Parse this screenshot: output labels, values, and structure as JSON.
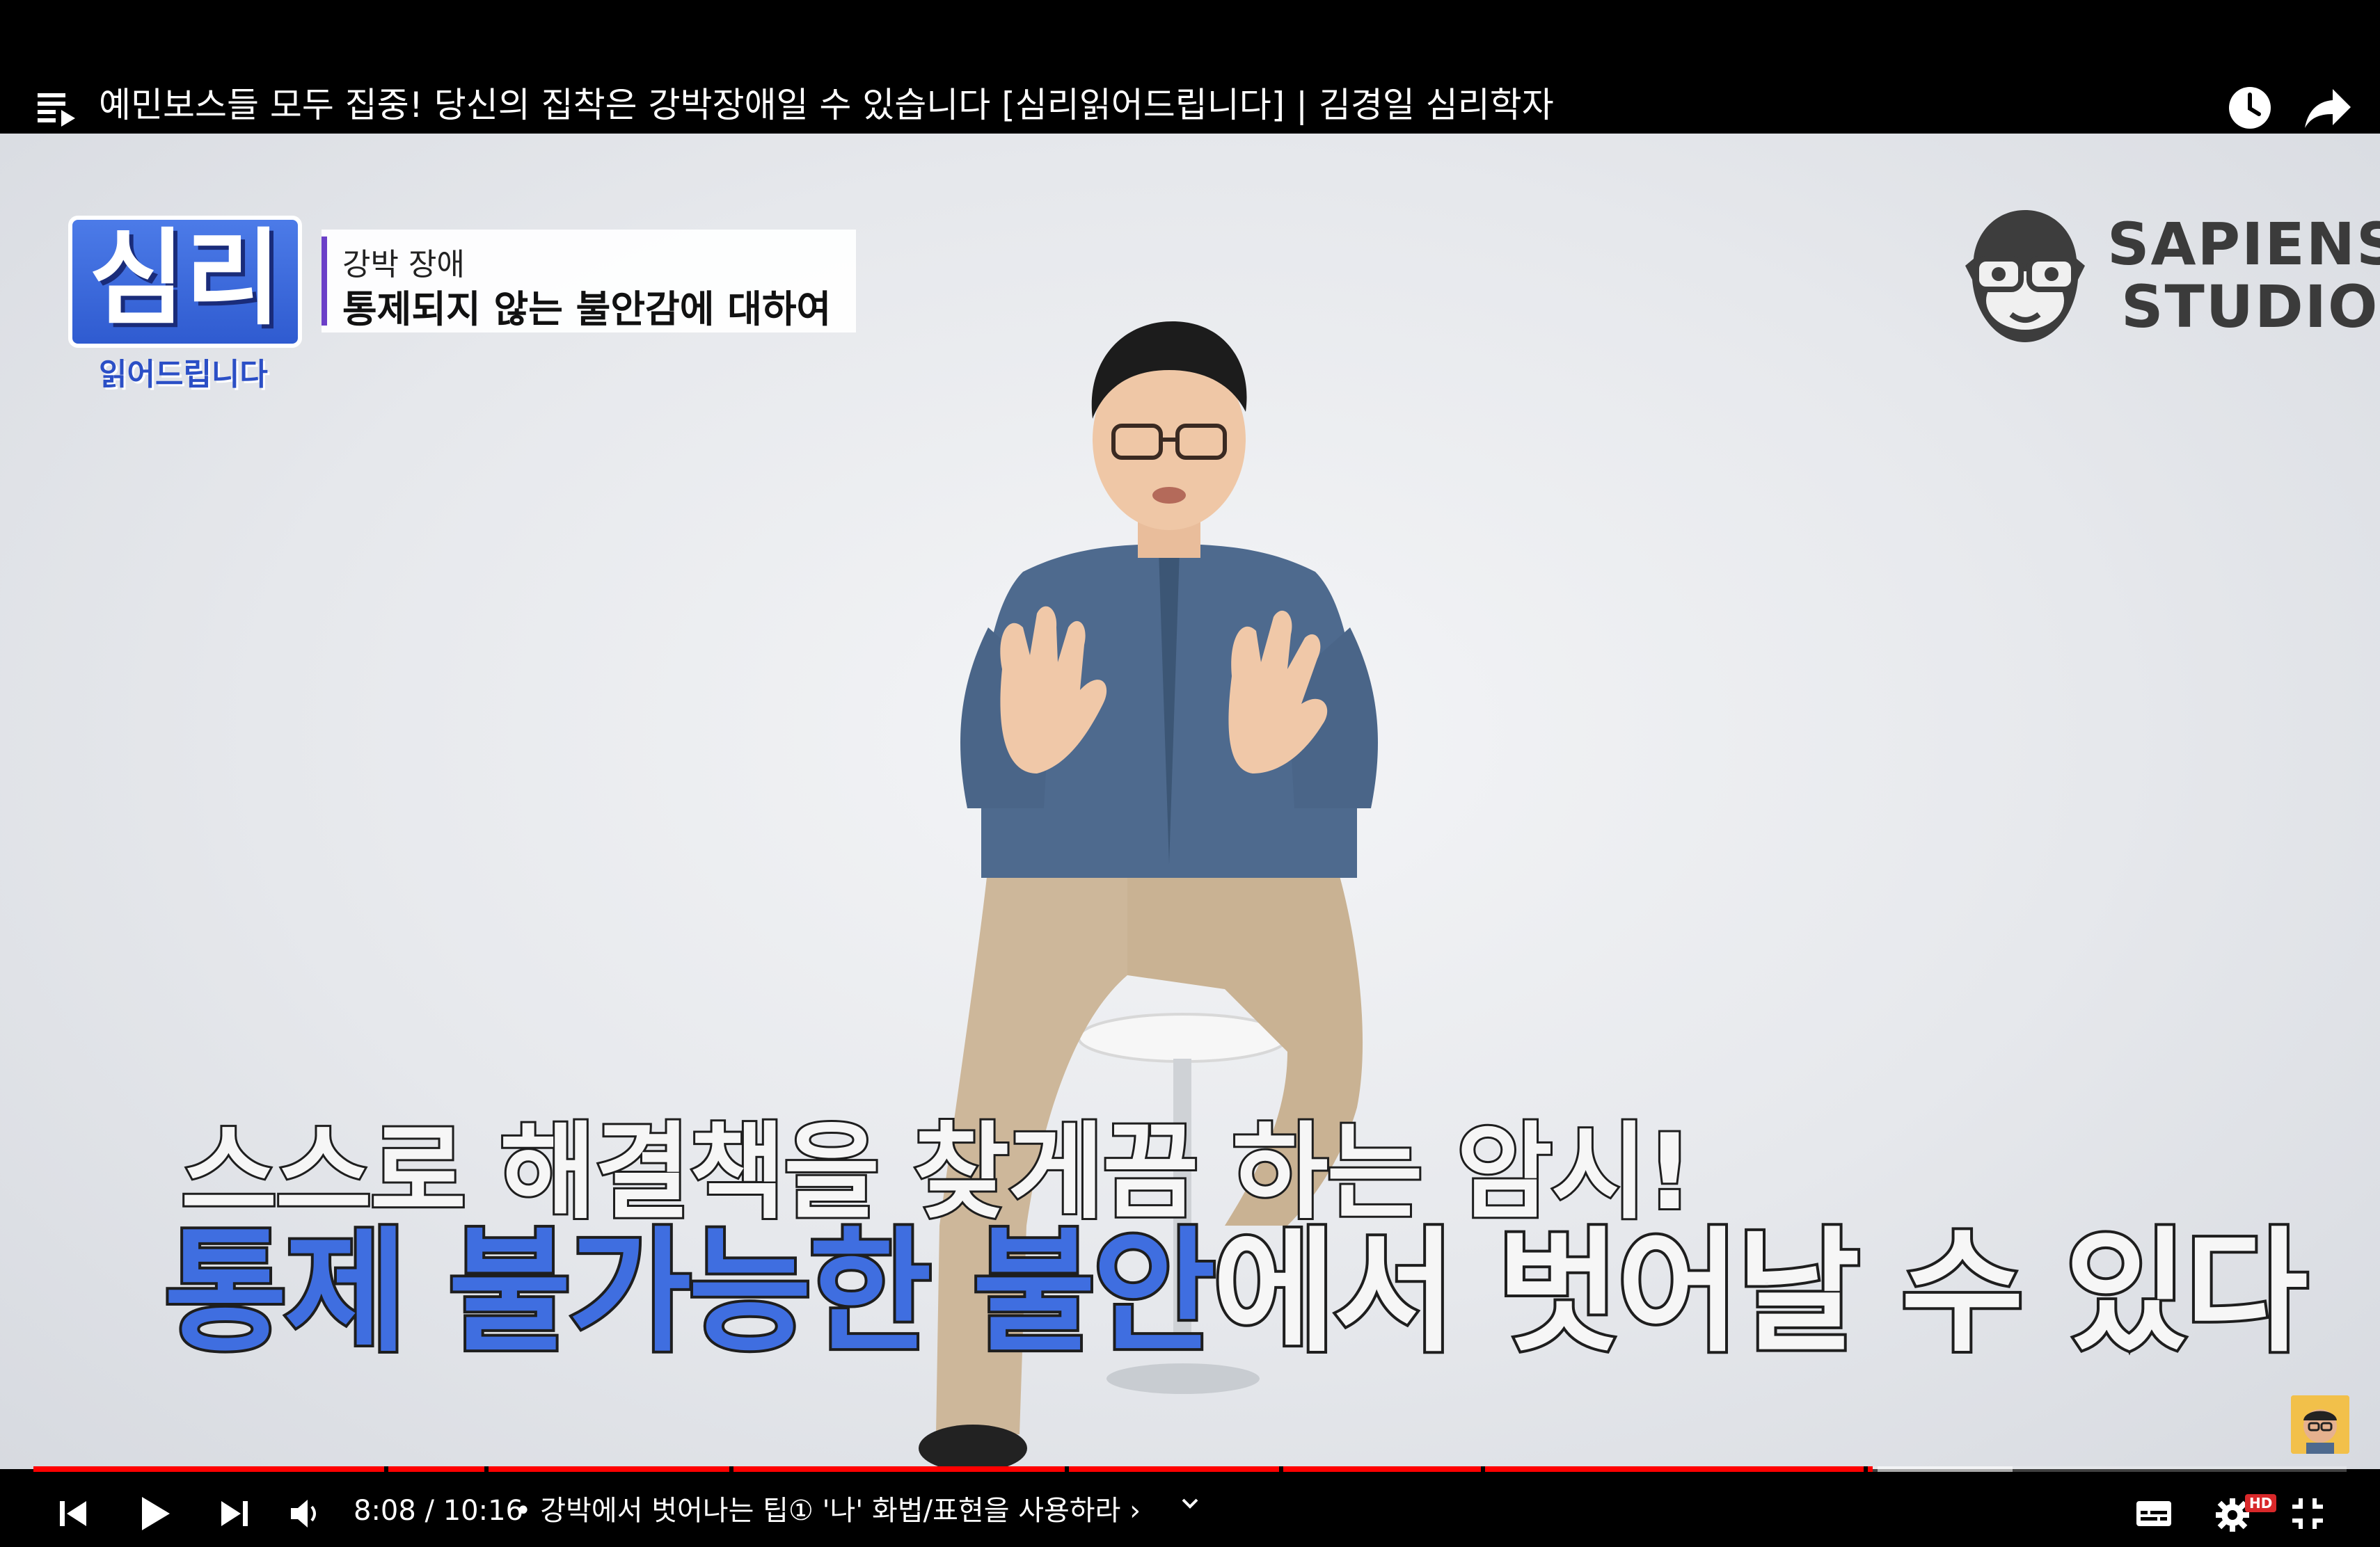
{
  "top_bar": {
    "title": "예민보스들 모두 집중! 당신의 집착은 강박장애일 수 있습니다 [심리읽어드립니다] | 김경일 심리학자",
    "icons": [
      "playlist-icon",
      "watch-later-icon",
      "share-icon"
    ]
  },
  "overlay": {
    "show_logo_main": "심리",
    "show_logo_sub": "읽어드립니다",
    "topic_small": "강박 장애",
    "topic_big": "통제되지 않는 불안감에 대하여",
    "studio_line1": "SAPIENS",
    "studio_line2": "STUDIO"
  },
  "subtitles": {
    "line1": "스스로 해결책을 찾게끔 하는 암시!",
    "line2_highlight": "통제 불가능한 불안",
    "line2_rest": "에서 벗어날 수 있다"
  },
  "player": {
    "progress_fraction": 0.795,
    "time_display": "8:08 / 10:16",
    "chapter": "• 강박에서 벗어나는 팁① '나' 화법/표현을 사용하라 ›",
    "hd_badge": "HD",
    "accent_color": "#ff0000",
    "highlight_color": "#3f6ee0",
    "controls": [
      "previous-icon",
      "play-icon",
      "next-icon",
      "volume-icon",
      "chapter-chevron-icon",
      "subtitles-icon",
      "settings-icon",
      "exit-fullscreen-icon"
    ]
  }
}
